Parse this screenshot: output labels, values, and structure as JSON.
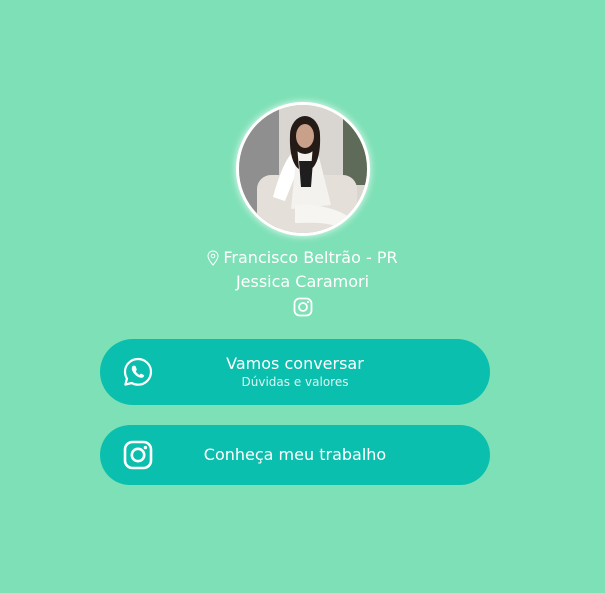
{
  "colors": {
    "background": "#7de0b6",
    "button": "#0bbfae",
    "text": "#ffffff"
  },
  "profile": {
    "location_icon": "map-pin-icon",
    "location": "Francisco Beltrão - PR",
    "name": "Jessica Caramori",
    "social_icon": "instagram-icon"
  },
  "buttons": [
    {
      "icon": "whatsapp-icon",
      "title": "Vamos conversar",
      "subtitle": "Dúvidas e valores"
    },
    {
      "icon": "instagram-icon",
      "title": "Conheça meu trabalho"
    }
  ]
}
